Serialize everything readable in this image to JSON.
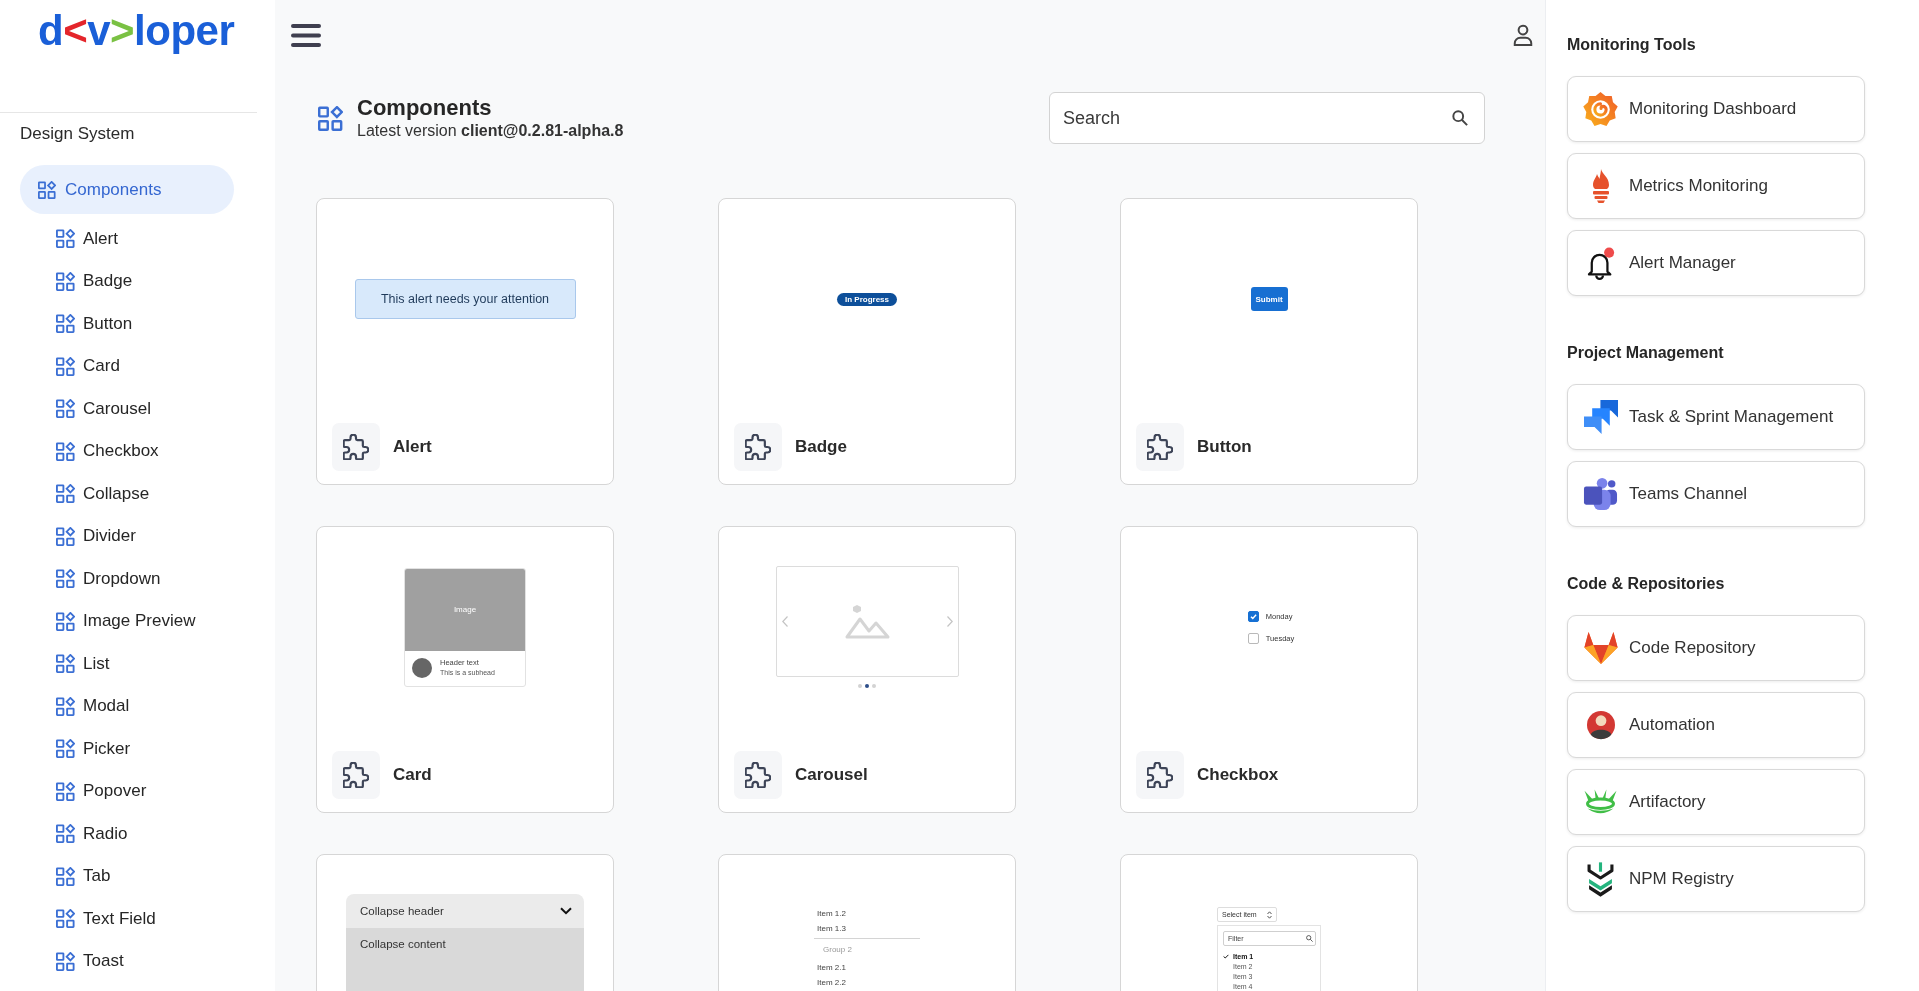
{
  "logo": [
    {
      "text": "d",
      "color": "#1a5fd8"
    },
    {
      "text": "<",
      "color": "#e4252b"
    },
    {
      "text": "v",
      "color": "#1a5fd8"
    },
    {
      "text": ">",
      "color": "#7ac143"
    },
    {
      "text": "loper",
      "color": "#1a5fd8"
    }
  ],
  "sidebar": {
    "title": "Design System",
    "items": [
      {
        "label": "Components",
        "selected": true,
        "children": [
          {
            "label": "Alert",
            "selected": false
          },
          {
            "label": "Badge",
            "selected": false
          },
          {
            "label": "Button",
            "selected": false
          },
          {
            "label": "Card",
            "selected": false
          },
          {
            "label": "Carousel",
            "selected": false
          },
          {
            "label": "Checkbox",
            "selected": false
          },
          {
            "label": "Collapse",
            "selected": false
          },
          {
            "label": "Divider",
            "selected": false
          },
          {
            "label": "Dropdown",
            "selected": false
          },
          {
            "label": "Image Preview",
            "selected": false
          },
          {
            "label": "List",
            "selected": false
          },
          {
            "label": "Modal",
            "selected": false
          },
          {
            "label": "Picker",
            "selected": false
          },
          {
            "label": "Popover",
            "selected": false
          },
          {
            "label": "Radio",
            "selected": false
          },
          {
            "label": "Tab",
            "selected": false
          },
          {
            "label": "Text Field",
            "selected": false
          },
          {
            "label": "Toast",
            "selected": false
          }
        ]
      }
    ]
  },
  "header": {
    "title": "Components",
    "subtitle": "Latest version **client@0.2.81-alpha.8**"
  },
  "search": {
    "placeholder": "Search"
  },
  "cards": [
    {
      "kind": "alert",
      "label": "Alert",
      "preview": {
        "message": "This alert needs your attention"
      }
    },
    {
      "kind": "badge",
      "label": "Badge",
      "preview": {
        "badge": "In Progress"
      }
    },
    {
      "kind": "button",
      "label": "Button",
      "preview": {
        "button": "Submit"
      }
    },
    {
      "kind": "card",
      "label": "Card",
      "preview": {
        "image": "Image",
        "header": "Header text",
        "subhead": "This is a subhead"
      }
    },
    {
      "kind": "carousel",
      "label": "Carousel",
      "preview": {
        "slides": [
          {
            "selected": false
          },
          {
            "selected": true
          },
          {
            "selected": false
          }
        ]
      }
    },
    {
      "kind": "checkbox",
      "label": "Checkbox",
      "preview": {
        "options": [
          {
            "label": "Monday",
            "checked": true
          },
          {
            "label": "Tuesday",
            "checked": false
          }
        ]
      }
    },
    {
      "kind": "collapse",
      "preview": {
        "header": "Collapse header",
        "content": "Collapse content",
        "expanded": true
      }
    },
    {
      "kind": "list",
      "preview": {
        "items": [
          {
            "kind": "item",
            "text": "Item 1.2"
          },
          {
            "kind": "item",
            "text": "Item 1.3"
          },
          {
            "kind": "group",
            "text": "Group 2"
          },
          {
            "kind": "item",
            "text": "Item 2.1"
          },
          {
            "kind": "item",
            "text": "Item 2.2"
          }
        ]
      }
    },
    {
      "kind": "dropdown",
      "preview": {
        "value": "Select item",
        "filter_placeholder": "Filter",
        "options": [
          {
            "label": "Item 1",
            "selected": true
          },
          {
            "label": "Item 2",
            "selected": false
          },
          {
            "label": "Item 3",
            "selected": false
          },
          {
            "label": "Item 4",
            "selected": false
          }
        ]
      }
    }
  ],
  "tool_sections": [
    {
      "title": "Monitoring Tools",
      "links": [
        {
          "kind": "dashboard",
          "label": "Monitoring Dashboard"
        },
        {
          "kind": "metrics",
          "label": "Metrics Monitoring"
        },
        {
          "kind": "alerts",
          "label": "Alert Manager"
        }
      ]
    },
    {
      "title": "Project Management",
      "links": [
        {
          "kind": "tasks",
          "label": "Task & Sprint Management"
        },
        {
          "kind": "chat",
          "label": "Teams Channel"
        }
      ]
    },
    {
      "title": "Code & Repositories",
      "links": [
        {
          "kind": "repository",
          "label": "Code Repository"
        },
        {
          "kind": "automation",
          "label": "Automation"
        },
        {
          "kind": "artifacts",
          "label": "Artifactory"
        },
        {
          "kind": "registry",
          "label": "NPM Registry"
        }
      ]
    }
  ]
}
